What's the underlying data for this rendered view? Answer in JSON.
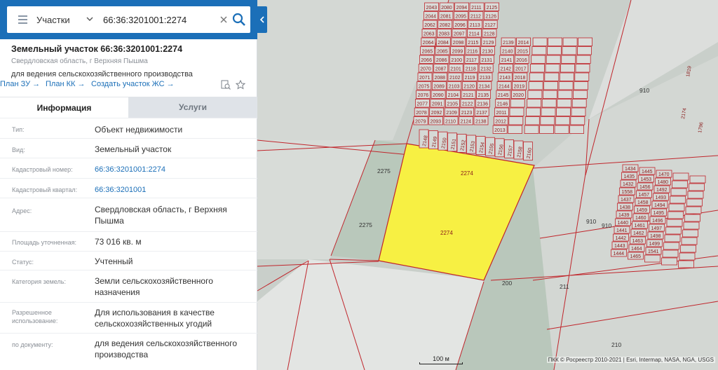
{
  "search": {
    "layer": "Участки",
    "query": "66:36:3201001:2274"
  },
  "parcel": {
    "title": "Земельный участок 66:36:3201001:2274",
    "region": "Свердловская область, г Верхняя Пышма",
    "purpose": "для ведения сельскохозяйственного производства"
  },
  "links": {
    "plan_zu": "План ЗУ →",
    "plan_kk": "План КК →",
    "create": "Создать участок ЖС →"
  },
  "tabs": {
    "info": "Информация",
    "services": "Услуги"
  },
  "info": [
    {
      "key": "Тип:",
      "value": "Объект недвижимости"
    },
    {
      "key": "Вид:",
      "value": "Земельный участок"
    },
    {
      "key": "Кадастровый номер:",
      "value": "66:36:3201001:2274"
    },
    {
      "key": "Кадастровый квартал:",
      "value": "66:36:3201001"
    },
    {
      "key": "Адрес:",
      "value": "Свердловская область, г Верхняя Пышма"
    },
    {
      "key": "Площадь уточненная:",
      "value": "73 016 кв. м"
    },
    {
      "key": "Статус:",
      "value": "Учтенный"
    },
    {
      "key": "Категория земель:",
      "value": "Земли сельскохозяйственного назначения"
    },
    {
      "key": "Разрешенное использование:",
      "value": "Для использования в качестве сельскохозяйственных угодий"
    },
    {
      "key": "по документу:",
      "value": "для ведения сельскохозяйственного производства"
    }
  ],
  "map": {
    "scale_label": "100 м",
    "attribution": "ПКК © Росреестр 2010-2021 | Esri, Intermap, NASA, NGA, USGS",
    "highlight_color": "#f7f043",
    "parcel_line_color": "#c0252b",
    "parcel_labels": [
      "2274",
      "2274",
      "2275",
      "2275",
      "910",
      "910",
      "910",
      "200",
      "211",
      "210",
      "1541",
      "1434",
      "1435",
      "1432",
      "1558",
      "1437",
      "1438",
      "1439",
      "1440",
      "1441",
      "1442",
      "1443",
      "1444",
      "1445",
      "1453",
      "1456",
      "1457",
      "1458",
      "1459",
      "1460",
      "1461",
      "1462",
      "1463",
      "1464",
      "1465",
      "1470",
      "1480",
      "1492",
      "1493",
      "1494",
      "1495",
      "1496",
      "1497",
      "1498",
      "1499",
      "1819",
      "1796",
      "2174",
      "2148",
      "2149",
      "2150",
      "2151",
      "2152",
      "2153",
      "2154",
      "2155",
      "2156",
      "2157",
      "2158",
      "2160",
      "2043",
      "2044",
      "2062",
      "2063",
      "2064",
      "2065",
      "2066",
      "2070",
      "2071",
      "2075",
      "2076",
      "2077",
      "2078",
      "2079",
      "2080",
      "2081",
      "2082",
      "2083",
      "2084",
      "2085",
      "2086",
      "2087",
      "2088",
      "2089",
      "2090",
      "2091",
      "2092",
      "2093",
      "2094",
      "2095",
      "2096",
      "2097",
      "2098",
      "2099",
      "2100",
      "2101",
      "2102",
      "2103",
      "2104",
      "2105",
      "2109",
      "2110",
      "2111",
      "2112",
      "2113",
      "2114",
      "2115",
      "2116",
      "2117",
      "2118",
      "2119",
      "2120",
      "2121",
      "2122",
      "2123",
      "2124",
      "2125",
      "2126",
      "2127",
      "2128",
      "2129",
      "2130",
      "2131",
      "2132",
      "2133",
      "2134",
      "2135",
      "2136",
      "2137",
      "2138",
      "2139",
      "2140",
      "2141",
      "2142",
      "2143",
      "2144",
      "2145",
      "2146",
      "2011",
      "2012",
      "2013",
      "2014",
      "2015",
      "2016",
      "2017",
      "2018",
      "2019",
      "2020"
    ]
  }
}
